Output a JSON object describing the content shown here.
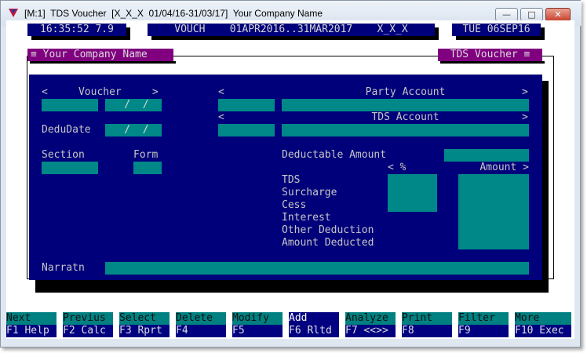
{
  "window": {
    "title": "[M:1]  TDS Voucher  [X_X_X  01/04/16-31/03/17]  Your Company Name",
    "min_symbol": "—",
    "max_symbol": "□",
    "close_symbol": "✕"
  },
  "status": {
    "time_ver": "16:35:52 7.9",
    "mode_period": "VOUCH    01APR2016..31MAR2017    X_X_X",
    "date": "TUE 06SEP16"
  },
  "tabs": {
    "company": "≡ Your Company Name",
    "form_title": "TDS Voucher ≡"
  },
  "form": {
    "voucher_label": "<     Voucher     >",
    "voucher_date_mask": " /  /",
    "dedudate_label": "DeduDate",
    "dedudate_mask": " /  /",
    "party_left_arrow": "<",
    "party_label": "Party Account",
    "party_right_arrow": ">",
    "tds_left_arrow": "<",
    "tds_label": "TDS Account",
    "tds_right_arrow": ">",
    "section_label": "Section",
    "form_label": "Form",
    "deductable_label": "Deductable Amount",
    "pct_header": "< %",
    "amount_header": "Amount >",
    "rows": [
      "TDS",
      "Surcharge",
      "Cess",
      "Interest",
      "Other Deduction",
      "Amount Deducted"
    ],
    "narration_label": "Narratn"
  },
  "fkeys": [
    {
      "top": "Next",
      "bottom": "F1 Help"
    },
    {
      "top": "Previus",
      "bottom": "F2 Calc"
    },
    {
      "top": "Select",
      "bottom": "F3 Rprt"
    },
    {
      "top": "Delete",
      "bottom": "F4"
    },
    {
      "top": "Modify",
      "bottom": "F5"
    },
    {
      "top": "Add",
      "bottom": "F6 Rltd"
    },
    {
      "top": "Analyze",
      "bottom": "F7 <<>>"
    },
    {
      "top": "Print",
      "bottom": "F8"
    },
    {
      "top": "Filter",
      "bottom": "F9"
    },
    {
      "top": "More",
      "bottom": "F10 Exec"
    }
  ],
  "colors": {
    "screen_blue": "#00007a",
    "field_teal": "#008888",
    "tab_purple": "#800080"
  }
}
